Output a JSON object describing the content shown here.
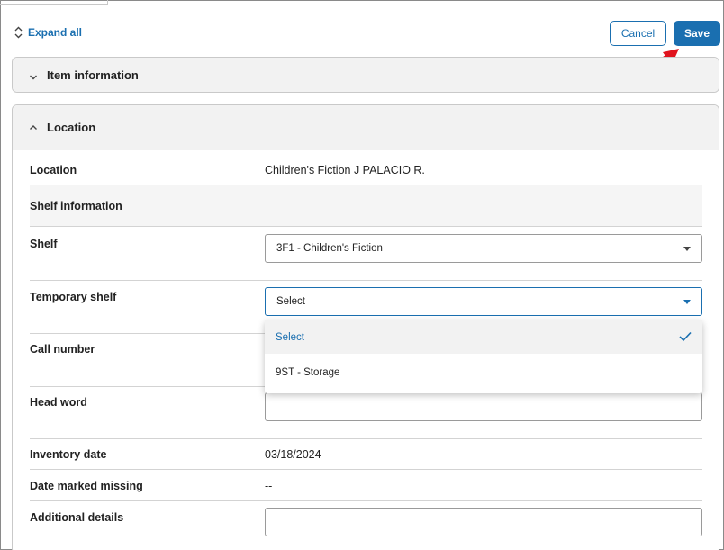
{
  "toolbar": {
    "expand_all": "Expand all",
    "cancel": "Cancel",
    "save": "Save"
  },
  "sections": {
    "item_information": "Item information",
    "location": "Location"
  },
  "fields": {
    "location_label": "Location",
    "location_value": "Children's Fiction J PALACIO R.",
    "shelf_information": "Shelf information",
    "shelf_label": "Shelf",
    "shelf_value": "3F1 - Children's Fiction",
    "temporary_shelf_label": "Temporary shelf",
    "temporary_shelf_value": "Select",
    "call_number_label": "Call number",
    "head_word_label": "Head word",
    "inventory_date_label": "Inventory date",
    "inventory_date_value": "03/18/2024",
    "date_missing_label": "Date marked missing",
    "date_missing_value": "--",
    "additional_details_label": "Additional details"
  },
  "dropdown": {
    "options": [
      "Select",
      "9ST - Storage"
    ],
    "selected": "Select"
  },
  "colors": {
    "accent": "#1a6fb0",
    "annotation_arrow": "#e0141e"
  }
}
